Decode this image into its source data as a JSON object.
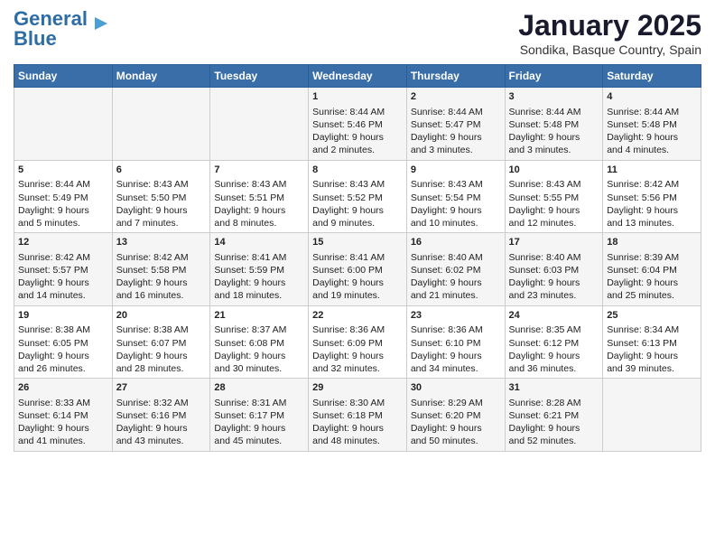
{
  "logo": {
    "line1": "General",
    "line2": "Blue"
  },
  "title": "January 2025",
  "location": "Sondika, Basque Country, Spain",
  "weekdays": [
    "Sunday",
    "Monday",
    "Tuesday",
    "Wednesday",
    "Thursday",
    "Friday",
    "Saturday"
  ],
  "weeks": [
    [
      {
        "day": "",
        "info": ""
      },
      {
        "day": "",
        "info": ""
      },
      {
        "day": "",
        "info": ""
      },
      {
        "day": "1",
        "info": "Sunrise: 8:44 AM\nSunset: 5:46 PM\nDaylight: 9 hours\nand 2 minutes."
      },
      {
        "day": "2",
        "info": "Sunrise: 8:44 AM\nSunset: 5:47 PM\nDaylight: 9 hours\nand 3 minutes."
      },
      {
        "day": "3",
        "info": "Sunrise: 8:44 AM\nSunset: 5:48 PM\nDaylight: 9 hours\nand 3 minutes."
      },
      {
        "day": "4",
        "info": "Sunrise: 8:44 AM\nSunset: 5:48 PM\nDaylight: 9 hours\nand 4 minutes."
      }
    ],
    [
      {
        "day": "5",
        "info": "Sunrise: 8:44 AM\nSunset: 5:49 PM\nDaylight: 9 hours\nand 5 minutes."
      },
      {
        "day": "6",
        "info": "Sunrise: 8:43 AM\nSunset: 5:50 PM\nDaylight: 9 hours\nand 7 minutes."
      },
      {
        "day": "7",
        "info": "Sunrise: 8:43 AM\nSunset: 5:51 PM\nDaylight: 9 hours\nand 8 minutes."
      },
      {
        "day": "8",
        "info": "Sunrise: 8:43 AM\nSunset: 5:52 PM\nDaylight: 9 hours\nand 9 minutes."
      },
      {
        "day": "9",
        "info": "Sunrise: 8:43 AM\nSunset: 5:54 PM\nDaylight: 9 hours\nand 10 minutes."
      },
      {
        "day": "10",
        "info": "Sunrise: 8:43 AM\nSunset: 5:55 PM\nDaylight: 9 hours\nand 12 minutes."
      },
      {
        "day": "11",
        "info": "Sunrise: 8:42 AM\nSunset: 5:56 PM\nDaylight: 9 hours\nand 13 minutes."
      }
    ],
    [
      {
        "day": "12",
        "info": "Sunrise: 8:42 AM\nSunset: 5:57 PM\nDaylight: 9 hours\nand 14 minutes."
      },
      {
        "day": "13",
        "info": "Sunrise: 8:42 AM\nSunset: 5:58 PM\nDaylight: 9 hours\nand 16 minutes."
      },
      {
        "day": "14",
        "info": "Sunrise: 8:41 AM\nSunset: 5:59 PM\nDaylight: 9 hours\nand 18 minutes."
      },
      {
        "day": "15",
        "info": "Sunrise: 8:41 AM\nSunset: 6:00 PM\nDaylight: 9 hours\nand 19 minutes."
      },
      {
        "day": "16",
        "info": "Sunrise: 8:40 AM\nSunset: 6:02 PM\nDaylight: 9 hours\nand 21 minutes."
      },
      {
        "day": "17",
        "info": "Sunrise: 8:40 AM\nSunset: 6:03 PM\nDaylight: 9 hours\nand 23 minutes."
      },
      {
        "day": "18",
        "info": "Sunrise: 8:39 AM\nSunset: 6:04 PM\nDaylight: 9 hours\nand 25 minutes."
      }
    ],
    [
      {
        "day": "19",
        "info": "Sunrise: 8:38 AM\nSunset: 6:05 PM\nDaylight: 9 hours\nand 26 minutes."
      },
      {
        "day": "20",
        "info": "Sunrise: 8:38 AM\nSunset: 6:07 PM\nDaylight: 9 hours\nand 28 minutes."
      },
      {
        "day": "21",
        "info": "Sunrise: 8:37 AM\nSunset: 6:08 PM\nDaylight: 9 hours\nand 30 minutes."
      },
      {
        "day": "22",
        "info": "Sunrise: 8:36 AM\nSunset: 6:09 PM\nDaylight: 9 hours\nand 32 minutes."
      },
      {
        "day": "23",
        "info": "Sunrise: 8:36 AM\nSunset: 6:10 PM\nDaylight: 9 hours\nand 34 minutes."
      },
      {
        "day": "24",
        "info": "Sunrise: 8:35 AM\nSunset: 6:12 PM\nDaylight: 9 hours\nand 36 minutes."
      },
      {
        "day": "25",
        "info": "Sunrise: 8:34 AM\nSunset: 6:13 PM\nDaylight: 9 hours\nand 39 minutes."
      }
    ],
    [
      {
        "day": "26",
        "info": "Sunrise: 8:33 AM\nSunset: 6:14 PM\nDaylight: 9 hours\nand 41 minutes."
      },
      {
        "day": "27",
        "info": "Sunrise: 8:32 AM\nSunset: 6:16 PM\nDaylight: 9 hours\nand 43 minutes."
      },
      {
        "day": "28",
        "info": "Sunrise: 8:31 AM\nSunset: 6:17 PM\nDaylight: 9 hours\nand 45 minutes."
      },
      {
        "day": "29",
        "info": "Sunrise: 8:30 AM\nSunset: 6:18 PM\nDaylight: 9 hours\nand 48 minutes."
      },
      {
        "day": "30",
        "info": "Sunrise: 8:29 AM\nSunset: 6:20 PM\nDaylight: 9 hours\nand 50 minutes."
      },
      {
        "day": "31",
        "info": "Sunrise: 8:28 AM\nSunset: 6:21 PM\nDaylight: 9 hours\nand 52 minutes."
      },
      {
        "day": "",
        "info": ""
      }
    ]
  ]
}
